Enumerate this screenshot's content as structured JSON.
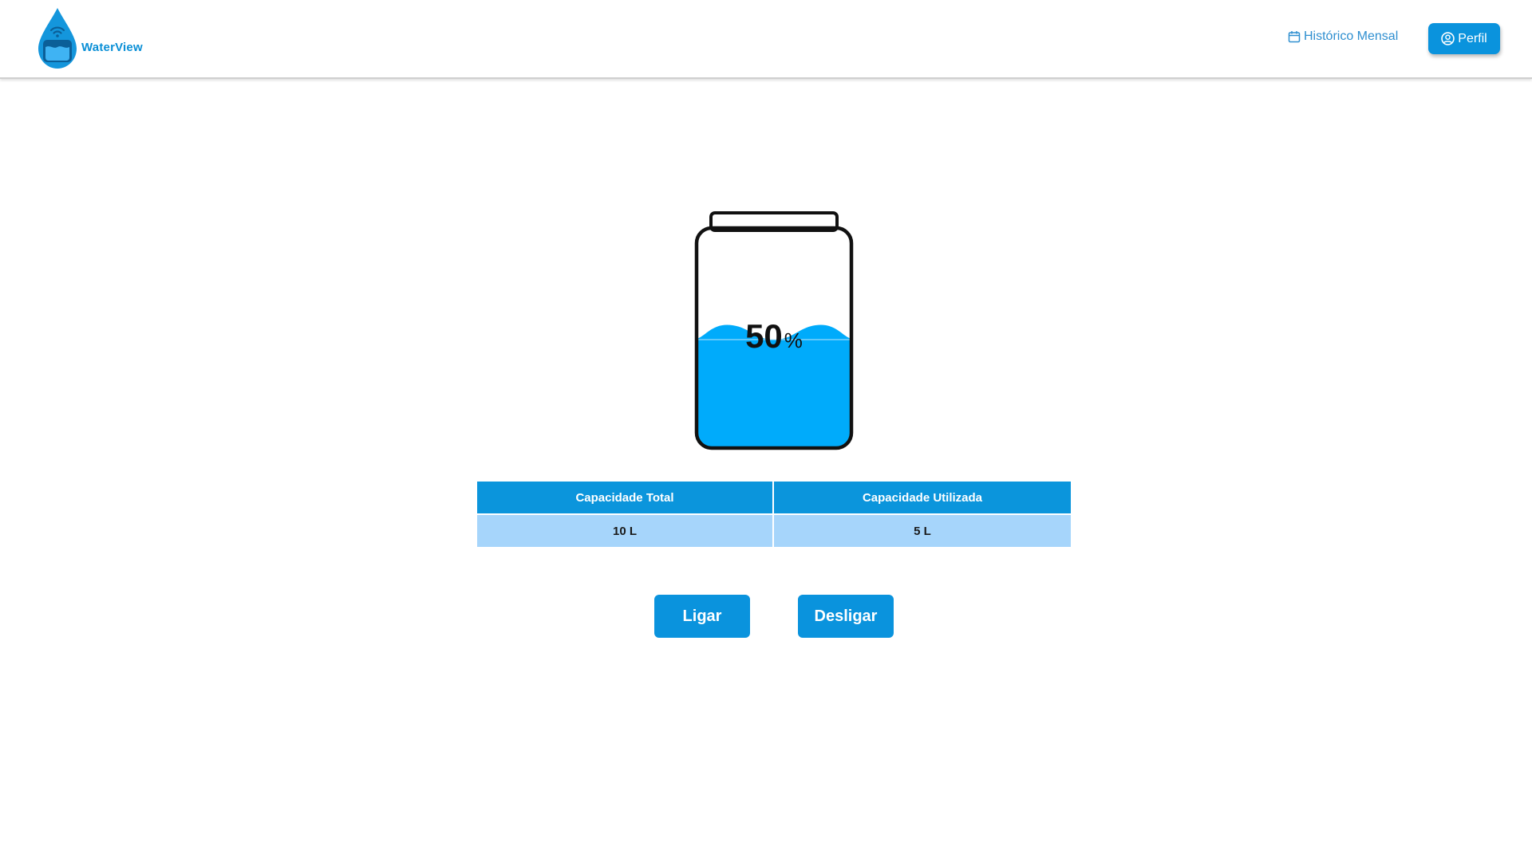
{
  "header": {
    "brand": "WaterView",
    "logo_icon": "water-drop-wifi-icon",
    "history_link_label": "Histórico Mensal",
    "history_icon": "calendar-icon",
    "profile_label": "Perfil",
    "profile_icon": "user-circle-icon"
  },
  "tank": {
    "level_percent": 50,
    "percent_value": "50",
    "percent_symbol": "%",
    "water_color": "#00abfb"
  },
  "capacity_table": {
    "headers": [
      "Capacidade Total",
      "Capacidade Utilizada"
    ],
    "values": [
      "10 L",
      "5 L"
    ]
  },
  "controls": {
    "on_label": "Ligar",
    "off_label": "Desligar"
  },
  "colors": {
    "primary": "#0a93dd",
    "table_row": "#a6d5fb",
    "link": "#2f8fd0"
  }
}
